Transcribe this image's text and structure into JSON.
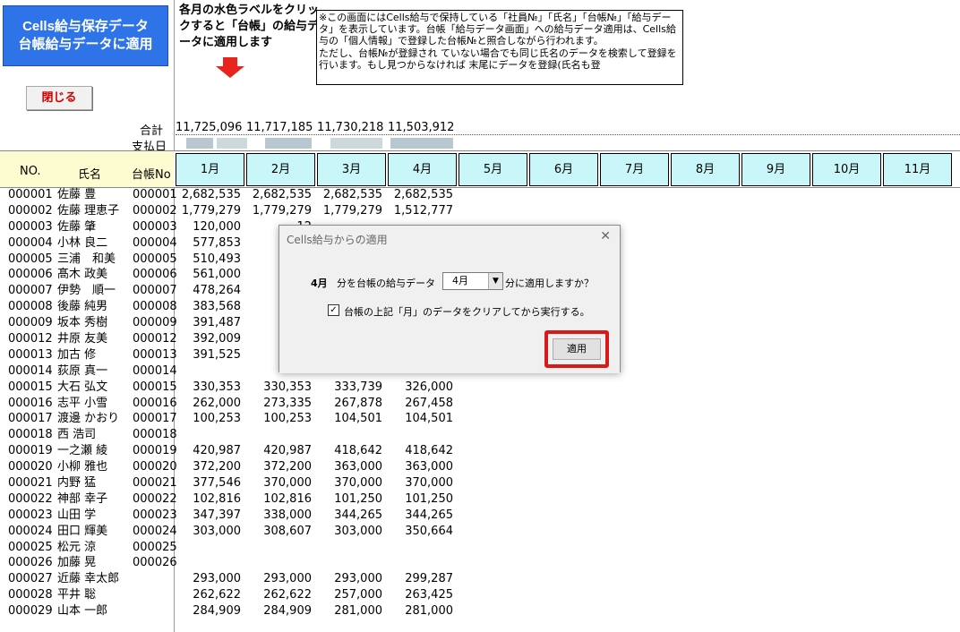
{
  "title_button": {
    "line1": "Cells給与保存データ",
    "line2": "台帳給与データに適用"
  },
  "close_button": "閉じる",
  "instruction": "各月の水色ラベルをクリックすると「台帳」の給与データに適用します",
  "note": "※この画面にはCells給与で保持している「社員№」「氏名」「台帳№」「給与データ」を表示しています。台帳「給与データ画面」への給与データ適用は、Cells給与の「個人情報」で登録した台帳№と照合しながら行われます。\nただし、台帳№が登録され ていない場合でも同じ氏名のデータを検索して登録を行います。もし見つからなければ 末尾にデータを登録(氏名も登",
  "totals_label": "合計",
  "payday_label": "支払日",
  "totals": [
    "11,725,096",
    "11,717,185",
    "11,730,218",
    "11,503,912"
  ],
  "headers": {
    "no": "NO.",
    "name": "氏名",
    "ledger": "台帳No"
  },
  "months": [
    "1月",
    "2月",
    "3月",
    "4月",
    "5月",
    "6月",
    "7月",
    "8月",
    "9月",
    "10月",
    "11月"
  ],
  "rows": [
    {
      "no": "000001",
      "name": "佐藤 豊",
      "ledger": "000001",
      "m": [
        "2,682,535",
        "2,682,535",
        "2,682,535",
        "2,682,535"
      ]
    },
    {
      "no": "000002",
      "name": "佐藤 理恵子",
      "ledger": "000002",
      "m": [
        "1,779,279",
        "1,779,279",
        "1,779,279",
        "1,512,777"
      ]
    },
    {
      "no": "000003",
      "name": "佐藤 肇",
      "ledger": "000003",
      "m": [
        "120,000",
        "12",
        "",
        ""
      ]
    },
    {
      "no": "000004",
      "name": "小林 良二",
      "ledger": "000004",
      "m": [
        "577,853",
        "58",
        "",
        ""
      ]
    },
    {
      "no": "000005",
      "name": "三浦　和美",
      "ledger": "000005",
      "m": [
        "510,493",
        "50",
        "",
        ""
      ]
    },
    {
      "no": "000006",
      "name": "髙木 政美",
      "ledger": "000006",
      "m": [
        "561,000",
        "56",
        "",
        ""
      ]
    },
    {
      "no": "000007",
      "name": "伊勢　順一",
      "ledger": "000007",
      "m": [
        "478,264",
        "47",
        "",
        ""
      ]
    },
    {
      "no": "000008",
      "name": "後藤 純男",
      "ledger": "000008",
      "m": [
        "383,568",
        "37",
        "",
        ""
      ]
    },
    {
      "no": "000009",
      "name": "坂本 秀樹",
      "ledger": "000009",
      "m": [
        "391,487",
        "38",
        "",
        ""
      ]
    },
    {
      "no": "000012",
      "name": "井原 友美",
      "ledger": "000012",
      "m": [
        "392,009",
        "39",
        "",
        ""
      ]
    },
    {
      "no": "000013",
      "name": "加古 修",
      "ledger": "000013",
      "m": [
        "391,525",
        "38",
        "",
        ""
      ]
    },
    {
      "no": "000014",
      "name": "荻原 真一",
      "ledger": "000014",
      "m": [
        "",
        "",
        "",
        ""
      ]
    },
    {
      "no": "000015",
      "name": "大石 弘文",
      "ledger": "000015",
      "m": [
        "330,353",
        "330,353",
        "333,739",
        "326,000"
      ]
    },
    {
      "no": "000016",
      "name": "志平 小雪",
      "ledger": "000016",
      "m": [
        "262,000",
        "273,335",
        "267,878",
        "267,458"
      ]
    },
    {
      "no": "000017",
      "name": "渡邊 かおり",
      "ledger": "000017",
      "m": [
        "100,253",
        "100,253",
        "104,501",
        "104,501"
      ]
    },
    {
      "no": "000018",
      "name": "西 浩司",
      "ledger": "000018",
      "m": [
        "",
        "",
        "",
        ""
      ]
    },
    {
      "no": "000019",
      "name": "一之瀬 綾",
      "ledger": "000019",
      "m": [
        "420,987",
        "420,987",
        "418,642",
        "418,642"
      ]
    },
    {
      "no": "000020",
      "name": "小柳 雅也",
      "ledger": "000020",
      "m": [
        "372,200",
        "372,200",
        "363,000",
        "363,000"
      ]
    },
    {
      "no": "000021",
      "name": "内野 猛",
      "ledger": "000021",
      "m": [
        "377,546",
        "370,000",
        "370,000",
        "370,000"
      ]
    },
    {
      "no": "000022",
      "name": "神部 幸子",
      "ledger": "000022",
      "m": [
        "102,816",
        "102,816",
        "101,250",
        "101,250"
      ]
    },
    {
      "no": "000023",
      "name": "山田 学",
      "ledger": "000023",
      "m": [
        "347,397",
        "338,000",
        "344,265",
        "344,265"
      ]
    },
    {
      "no": "000024",
      "name": "田口 輝美",
      "ledger": "000024",
      "m": [
        "303,000",
        "308,607",
        "303,000",
        "350,664"
      ]
    },
    {
      "no": "000025",
      "name": "松元 涼",
      "ledger": "000025",
      "m": [
        "",
        "",
        "",
        ""
      ]
    },
    {
      "no": "000026",
      "name": "加藤 晃",
      "ledger": "000026",
      "m": [
        "",
        "",
        "",
        ""
      ]
    },
    {
      "no": "000027",
      "name": "近藤 幸太郎",
      "ledger": "",
      "m": [
        "293,000",
        "293,000",
        "293,000",
        "299,287"
      ]
    },
    {
      "no": "000028",
      "name": "平井 聡",
      "ledger": "",
      "m": [
        "262,622",
        "262,622",
        "257,000",
        "263,425"
      ]
    },
    {
      "no": "000029",
      "name": "山本 一郎",
      "ledger": "",
      "m": [
        "284,909",
        "284,909",
        "281,000",
        "281,000"
      ]
    }
  ],
  "dialog": {
    "title": "Cells給与からの適用",
    "month_bold": "4月",
    "text1": "分を台帳の給与データ",
    "select_value": "4月",
    "text2": "分に適用しますか？",
    "checkbox_checked": true,
    "checkbox_label": "台帳の上記「月」のデータをクリアしてから実行する。",
    "apply_button": "適用"
  },
  "colors": {
    "title_blue": "#2e74e8",
    "month_cyan": "#c9f7f9",
    "header_yellow": "#fdfbd0",
    "close_red": "#d00000",
    "highlight_red": "#d91a1a",
    "arrow_red": "#e8241c"
  },
  "icons": {
    "arrow": "down-arrow-icon",
    "close": "close-icon",
    "dropdown": "chevron-down-icon",
    "check": "checkmark-icon"
  }
}
